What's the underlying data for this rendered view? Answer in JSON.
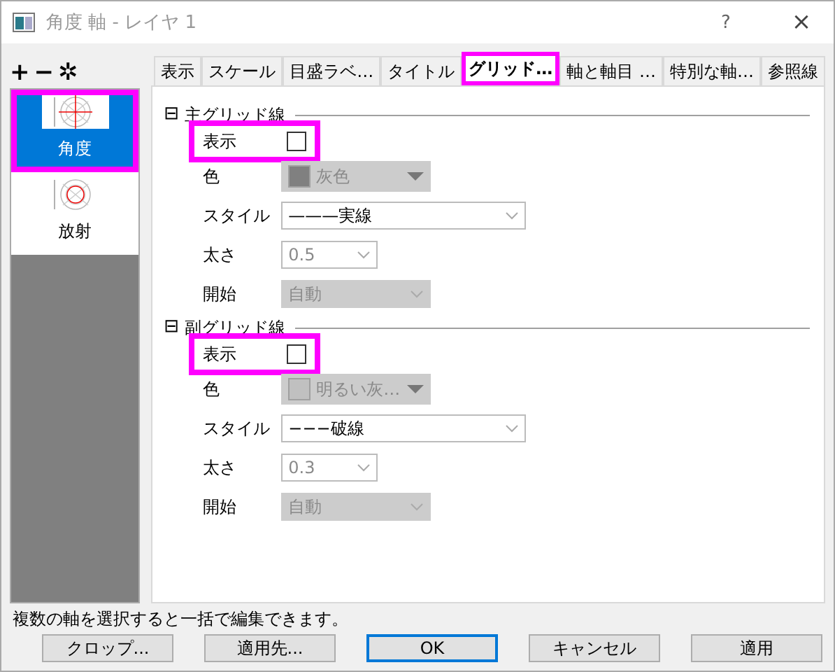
{
  "window": {
    "title": "角度 軸 - レイヤ 1",
    "help": "?",
    "close": "×"
  },
  "toolbar": [
    "+",
    "−",
    "✲"
  ],
  "axes": [
    {
      "label": "角度",
      "kind": "angle",
      "selected": true,
      "highlighted": true
    },
    {
      "label": "放射",
      "kind": "radial",
      "selected": false,
      "highlighted": false
    }
  ],
  "tabs": [
    {
      "label": "表示",
      "selected": false,
      "highlighted": false
    },
    {
      "label": "スケール",
      "selected": false,
      "highlighted": false
    },
    {
      "label": "目盛ラベ…",
      "selected": false,
      "highlighted": false
    },
    {
      "label": "タイトル",
      "selected": false,
      "highlighted": false
    },
    {
      "label": "グリッド…",
      "selected": true,
      "highlighted": true
    },
    {
      "label": "軸と軸目 …",
      "selected": false,
      "highlighted": false
    },
    {
      "label": "特別な軸…",
      "selected": false,
      "highlighted": false
    },
    {
      "label": "参照線",
      "selected": false,
      "highlighted": false
    }
  ],
  "sections": [
    {
      "toggle": "⊟",
      "title": "主グリッド線",
      "expanded": true,
      "rows": [
        {
          "kind": "checkbox",
          "label": "表示",
          "checked": false,
          "highlighted": true
        },
        {
          "kind": "color",
          "label": "色",
          "value": "灰色",
          "color": "#808080",
          "disabled": true
        },
        {
          "kind": "combo",
          "label": "スタイル",
          "value": "———実線",
          "disabled": false
        },
        {
          "kind": "combo",
          "label": "太さ",
          "value": "0.5",
          "disabled": true,
          "editable": true
        },
        {
          "kind": "combo",
          "label": "開始",
          "value": "自動",
          "disabled": true,
          "editable": false
        }
      ]
    },
    {
      "toggle": "⊟",
      "title": "副グリッド線",
      "expanded": true,
      "rows": [
        {
          "kind": "checkbox",
          "label": "表示",
          "checked": false,
          "highlighted": true
        },
        {
          "kind": "color",
          "label": "色",
          "value": "明るい灰…",
          "color": "#c0c0c0",
          "disabled": true
        },
        {
          "kind": "combo",
          "label": "スタイル",
          "value": "−−−破線",
          "disabled": false
        },
        {
          "kind": "combo",
          "label": "太さ",
          "value": "0.3",
          "disabled": true,
          "editable": true
        },
        {
          "kind": "combo",
          "label": "開始",
          "value": "自動",
          "disabled": true,
          "editable": false
        }
      ]
    }
  ],
  "status": "複数の軸を選択すると一括で編集できます。",
  "buttons": [
    {
      "label": "クロップ...",
      "default": false
    },
    {
      "label": "適用先...",
      "default": false
    },
    {
      "label": "OK",
      "default": true
    },
    {
      "label": "キャンセル",
      "default": false
    },
    {
      "label": "適用",
      "default": false
    }
  ]
}
